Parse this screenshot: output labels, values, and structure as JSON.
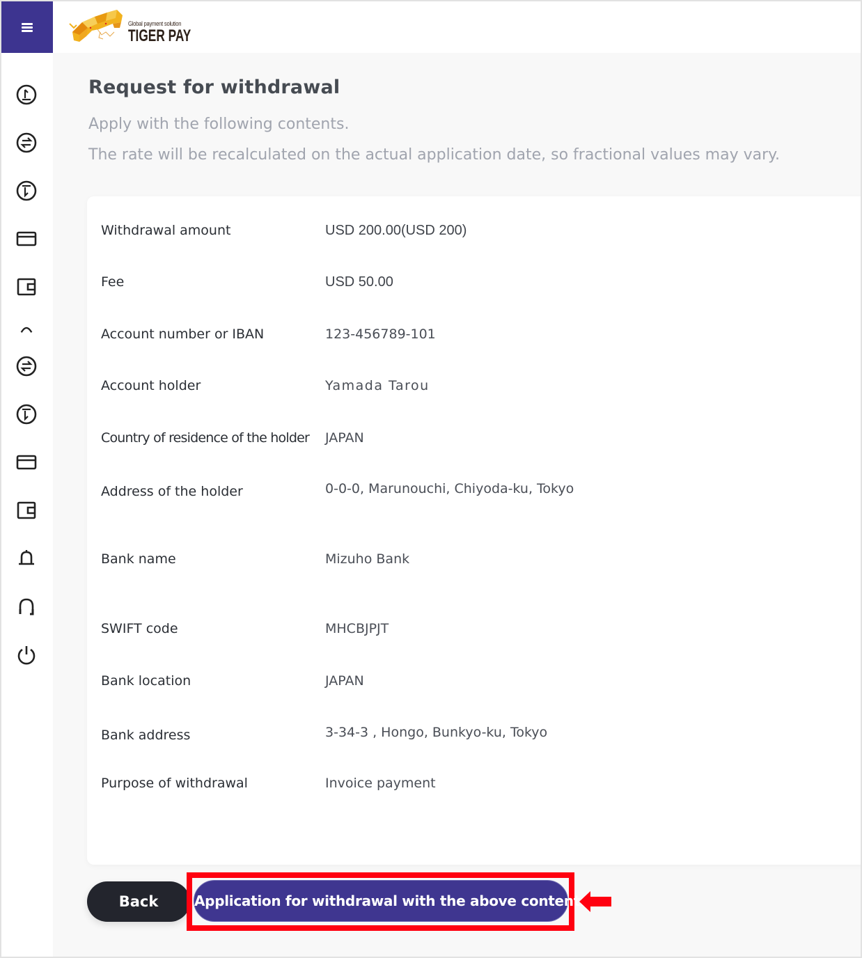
{
  "header": {
    "menu_icon": "hamburger-menu-icon",
    "logo": {
      "tagline": "Global payment solution",
      "brand": "TIGER PAY",
      "mascot_icon": "tiger-logo-icon"
    }
  },
  "sidebar": {
    "items": [
      {
        "icon": "deposit-icon"
      },
      {
        "icon": "exchange-icon"
      },
      {
        "icon": "withdraw-icon"
      },
      {
        "icon": "card-icon"
      },
      {
        "icon": "wallet-icon"
      },
      {
        "icon": "collapse-up-icon"
      },
      {
        "icon": "exchange-icon"
      },
      {
        "icon": "withdraw-icon"
      },
      {
        "icon": "card-icon"
      },
      {
        "icon": "wallet-icon"
      },
      {
        "icon": "bell-icon"
      },
      {
        "icon": "headset-icon"
      },
      {
        "icon": "power-icon"
      }
    ]
  },
  "main": {
    "title": "Request for withdrawal",
    "subtitle_1": "Apply with the following contents.",
    "subtitle_2": "The rate will be recalculated on the actual application date, so fractional values may vary.",
    "details": [
      {
        "label": "Withdrawal amount",
        "value": "USD 200.00(USD 200)"
      },
      {
        "label": "Fee",
        "value": "USD 50.00"
      },
      {
        "label": "Account number or IBAN",
        "value": "123-456789-101"
      },
      {
        "label": "Account holder",
        "value": "Yamada Tarou"
      },
      {
        "label": "Country of residence of the holder",
        "value": "JAPAN"
      },
      {
        "label": "Address of the holder",
        "value": "0-0-0, Marunouchi, Chiyoda-ku, Tokyo"
      },
      {
        "label": "Bank name",
        "value": "Mizuho Bank"
      },
      {
        "label": "SWIFT code",
        "value": "MHCBJPJT"
      },
      {
        "label": "Bank location",
        "value": "JAPAN"
      },
      {
        "label": "Bank address",
        "value": "3-34-3 , Hongo, Bunkyo-ku, Tokyo"
      },
      {
        "label": "Purpose of withdrawal",
        "value": "Invoice payment"
      }
    ],
    "buttons": {
      "back": "Back",
      "apply": "Application for withdrawal with the above contents"
    }
  },
  "annotation": {
    "highlight_color": "#ff0010",
    "arrow_icon": "left-arrow-icon"
  },
  "colors": {
    "brand_primary": "#3d3490",
    "back_button": "#23252d"
  }
}
